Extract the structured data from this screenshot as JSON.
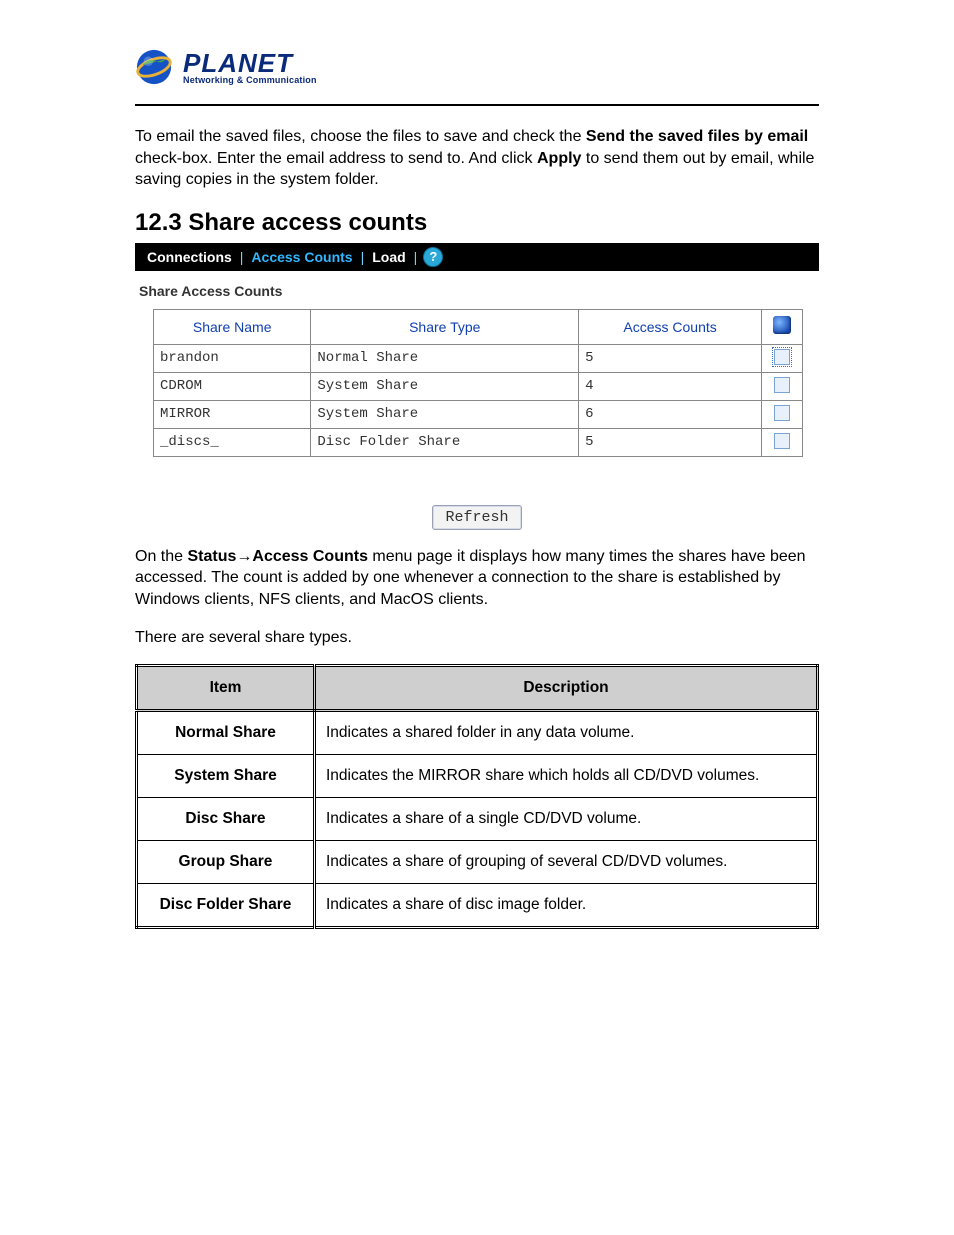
{
  "logo": {
    "word": "PLANET",
    "sub": "Networking & Communication"
  },
  "intro": {
    "pre": "To email the saved files, choose the files to save and check the ",
    "bold1": "Send the saved files by email",
    "mid": " check-box. Enter the email address to send to. And click ",
    "bold2": "Apply",
    "post": " to send them out by email, while saving copies in the system folder."
  },
  "section_title": "12.3 Share access counts",
  "tabbar": {
    "items": [
      "Connections",
      "Access Counts",
      "Load"
    ],
    "active_index": 1,
    "help": "?"
  },
  "sac": {
    "title": "Share Access Counts",
    "headers": [
      "Share Name",
      "Share Type",
      "Access Counts"
    ],
    "rows": [
      {
        "name": "brandon",
        "type": "Normal Share",
        "count": "5",
        "selected": true
      },
      {
        "name": "CDROM",
        "type": "System Share",
        "count": "4",
        "selected": false
      },
      {
        "name": "MIRROR",
        "type": "System Share",
        "count": "6",
        "selected": false
      },
      {
        "name": "_discs_",
        "type": "Disc Folder Share",
        "count": "5",
        "selected": false
      }
    ]
  },
  "refresh_label": "Refresh",
  "para2": {
    "pre": "On the ",
    "bold": "Status→Access Counts",
    "post": " menu page it displays how many times the shares have been accessed. The count is added by one whenever a connection to the share is established by Windows clients, NFS clients, and MacOS clients."
  },
  "para3": "There are several share types.",
  "desc_table": {
    "headers": [
      "Item",
      "Description"
    ],
    "rows": [
      {
        "item": "Normal Share",
        "desc": "Indicates a shared folder in any data volume."
      },
      {
        "item": "System Share",
        "desc": "Indicates the MIRROR share which holds all CD/DVD volumes."
      },
      {
        "item": "Disc Share",
        "desc": "Indicates a share of a single CD/DVD volume."
      },
      {
        "item": "Group Share",
        "desc": "Indicates a share of grouping of several CD/DVD volumes."
      },
      {
        "item": "Disc Folder Share",
        "desc": "Indicates a share of disc image folder."
      }
    ]
  }
}
